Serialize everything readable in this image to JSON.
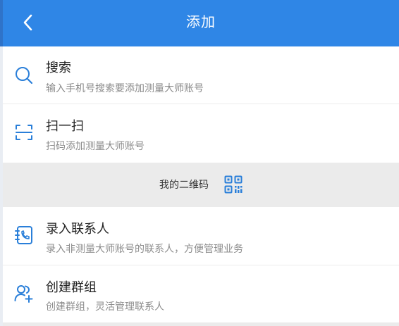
{
  "header": {
    "title": "添加",
    "back_icon": "chevron-left-icon"
  },
  "menu": {
    "search": {
      "title": "搜索",
      "subtitle": "输入手机号搜索要添加测量大师账号",
      "icon": "search-icon"
    },
    "scan": {
      "title": "扫一扫",
      "subtitle": "扫码添加测量大师账号",
      "icon": "scan-icon"
    },
    "contact": {
      "title": "录入联系人",
      "subtitle": "录入非测量大师账号的联系人，方便管理业务",
      "icon": "phone-book-icon"
    },
    "group": {
      "title": "创建群组",
      "subtitle": "创建群组，灵活管理联系人",
      "icon": "add-group-icon"
    }
  },
  "qr_section": {
    "label": "我的二维码",
    "icon": "qr-code-icon"
  },
  "colors": {
    "header_bg": "#2f86e6",
    "icon_blue": "#2a7fd9",
    "section_bg": "#ebebeb"
  }
}
